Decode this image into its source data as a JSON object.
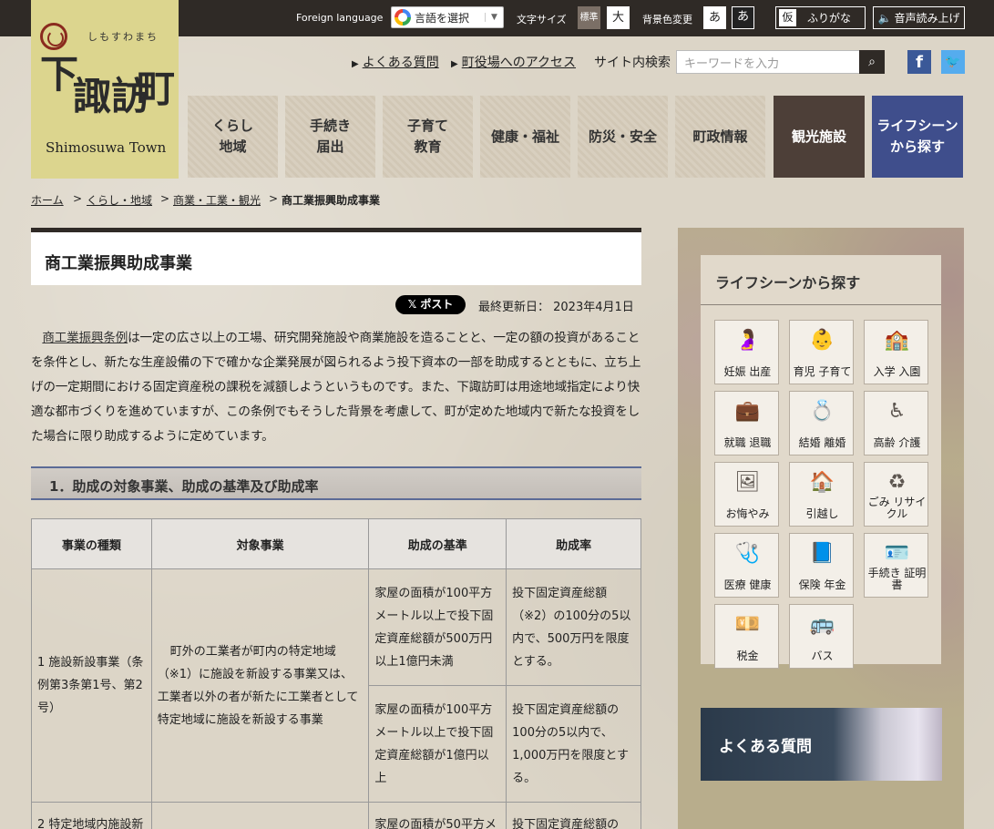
{
  "topbar": {
    "foreign_label": "Foreign language",
    "translate_label": "言語を選択",
    "fontsize_label": "文字サイズ",
    "fontsize_std": "標準",
    "fontsize_big": "大",
    "bgcolor_label": "背景色変更",
    "bg_light": "あ",
    "bg_dark": "あ",
    "furigana_mark": "仮",
    "furigana_label": "ふりがな",
    "voice_label": "音声読み上げ"
  },
  "logo": {
    "kana": "しもすわまち",
    "kanji1": "下",
    "kanji2": "諏訪",
    "kanji3": "町",
    "en": "Shimosuwa Town"
  },
  "util": {
    "faq_link": "よくある質問",
    "access_link": "町役場へのアクセス",
    "search_label": "サイト内検索",
    "search_placeholder": "キーワードを入力"
  },
  "nav": [
    {
      "l1": "くらし",
      "l2": "地域"
    },
    {
      "l1": "手続き",
      "l2": "届出"
    },
    {
      "l1": "子育て",
      "l2": "教育"
    },
    {
      "l1": "健康・福祉",
      "l2": ""
    },
    {
      "l1": "防災・安全",
      "l2": ""
    },
    {
      "l1": "町政情報",
      "l2": ""
    },
    {
      "l1": "観光施設",
      "l2": ""
    },
    {
      "l1": "ライフシーン",
      "l2": "から探す"
    }
  ],
  "breadcrumb": [
    "ホーム",
    "くらし・地域",
    "商業・工業・観光",
    "商工業振興助成事業"
  ],
  "page": {
    "title": "商工業振興助成事業",
    "x_post": "ポスト",
    "updated": "最終更新日： 2023年4月1日",
    "intro_link": "商工業振興条例",
    "intro_rest": "は一定の広さ以上の工場、研究開発施設や商業施設を造ることと、一定の額の投資があることを条件とし、新たな生産設備の下で確かな企業発展が図られるよう投下資本の一部を助成するとともに、立ち上げの一定期間における固定資産税の課税を減額しようというものです。また、下諏訪町は用途地域指定により快適な都市づくりを進めていますが、この条例でもそうした背景を考慮して、町が定めた地域内で新たな投資をした場合に限り助成するように定めています。",
    "section1": "1．助成の対象事業、助成の基準及び助成率"
  },
  "table": {
    "headers": [
      "事業の種類",
      "対象事業",
      "助成の基準",
      "助成率"
    ],
    "row1_type": "1 施設新設事業（条例第3条第1号、第2号）",
    "row1_target": "町外の工業者が町内の特定地域（※1）に施設を新設する事業又は、工業者以外の者が新たに工業者として特定地域に施設を新設する事業",
    "row1a_basis": "家屋の面積が100平方メートル以上で投下固定資産総額が500万円以上1億円未満",
    "row1a_rate": "投下固定資産総額（※2）の100分の5以内で、500万円を限度とする。",
    "row1b_basis": "家屋の面積が100平方メートル以上で投下固定資産総額が1億円以上",
    "row1b_rate": "投下固定資産総額の100分の5以内で、1,000万円を限度とする。",
    "row2_type": "2 特定地域内施設新",
    "row2_basis": "家屋の面積が50平方メ",
    "row2_rate": "投下固定資産総額の"
  },
  "sidebar": {
    "title": "ライフシーンから探す",
    "tiles": [
      {
        "label": "妊娠 出産",
        "icon": "pregnancy-icon"
      },
      {
        "label": "育児 子育て",
        "icon": "childcare-icon"
      },
      {
        "label": "入学 入園",
        "icon": "school-icon"
      },
      {
        "label": "就職 退職",
        "icon": "job-icon"
      },
      {
        "label": "結婚 離婚",
        "icon": "ring-icon"
      },
      {
        "label": "高齢 介護",
        "icon": "wheelchair-icon"
      },
      {
        "label": "お悔やみ",
        "icon": "condolence-icon"
      },
      {
        "label": "引越し",
        "icon": "house-icon"
      },
      {
        "label": "ごみ リサイクル",
        "icon": "recycle-icon"
      },
      {
        "label": "医療 健康",
        "icon": "stethoscope-icon"
      },
      {
        "label": "保険 年金",
        "icon": "insurance-icon"
      },
      {
        "label": "手続き 証明書",
        "icon": "certificate-icon"
      },
      {
        "label": "税金",
        "icon": "tax-icon"
      },
      {
        "label": "バス",
        "icon": "bus-icon"
      }
    ],
    "faq_banner": "よくある質問"
  },
  "colors": {
    "topbar": "#2f2a26",
    "logo_bg": "#dcd58e",
    "nav_tourism": "#4d3f38",
    "nav_lifescene": "#3f4e8c",
    "section_border": "#5b6b96"
  }
}
